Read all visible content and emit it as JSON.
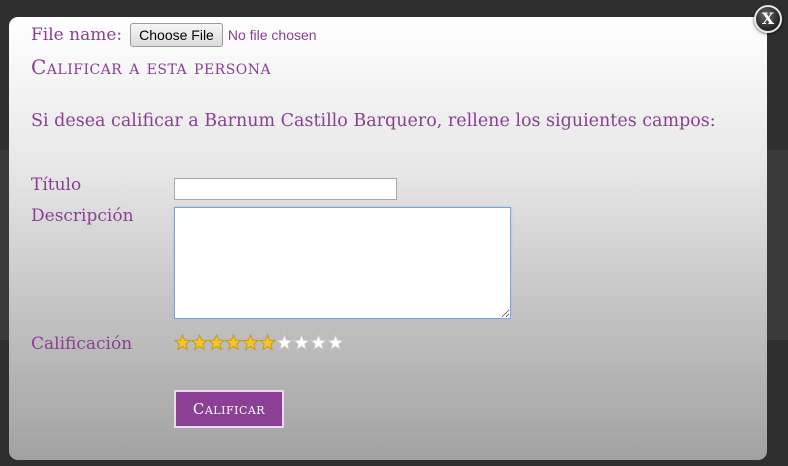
{
  "modal": {
    "close_label": "X",
    "file_label": "File name:",
    "file_button": "Choose File",
    "file_status": "No file chosen",
    "heading": "Calificar a esta persona",
    "intro": "Si desea calificar a Barnum Castillo Barquero, rellene los siguientes campos:",
    "title_label": "Título",
    "description_label": "Descripción",
    "rating_label": "Calificación",
    "submit_label": "Calificar"
  },
  "rating": {
    "value": 6,
    "max": 10,
    "colors": {
      "filled": "#f3c431",
      "empty": "#ffffff"
    }
  },
  "colors": {
    "accent": "#8a3f93",
    "button_bg": "#8b3f95",
    "modal_top": "#ffffff",
    "modal_bottom": "#a2a2a2"
  }
}
